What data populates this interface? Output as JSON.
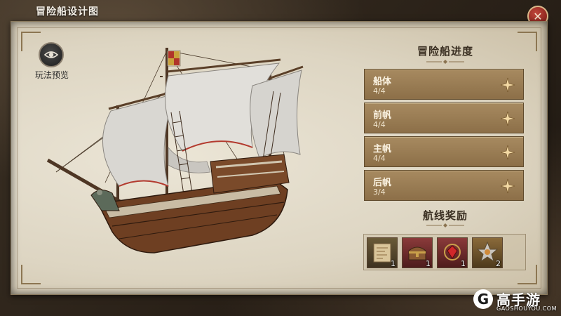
{
  "header": {
    "title": "冒险船设计图",
    "close_icon": "close-icon"
  },
  "preview": {
    "label": "玩法预览",
    "icon": "eye-icon"
  },
  "progress": {
    "title": "冒险船进度",
    "items": [
      {
        "name": "船体",
        "value": "4/4"
      },
      {
        "name": "前帆",
        "value": "4/4"
      },
      {
        "name": "主帆",
        "value": "4/4"
      },
      {
        "name": "后帆",
        "value": "3/4"
      }
    ]
  },
  "rewards": {
    "title": "航线奖励",
    "items": [
      {
        "icon": "scroll-map-icon",
        "count": "1"
      },
      {
        "icon": "treasure-chest-icon",
        "count": "1"
      },
      {
        "icon": "red-gem-icon",
        "count": "1"
      },
      {
        "icon": "star-medal-icon",
        "count": "2"
      }
    ]
  },
  "watermark": {
    "logo": "G",
    "name": "高手游",
    "url": "GAOSHOUYOU.COM"
  },
  "colors": {
    "panel": "#e4ddcb",
    "row": "#9c7f55",
    "close": "#a22a20"
  }
}
